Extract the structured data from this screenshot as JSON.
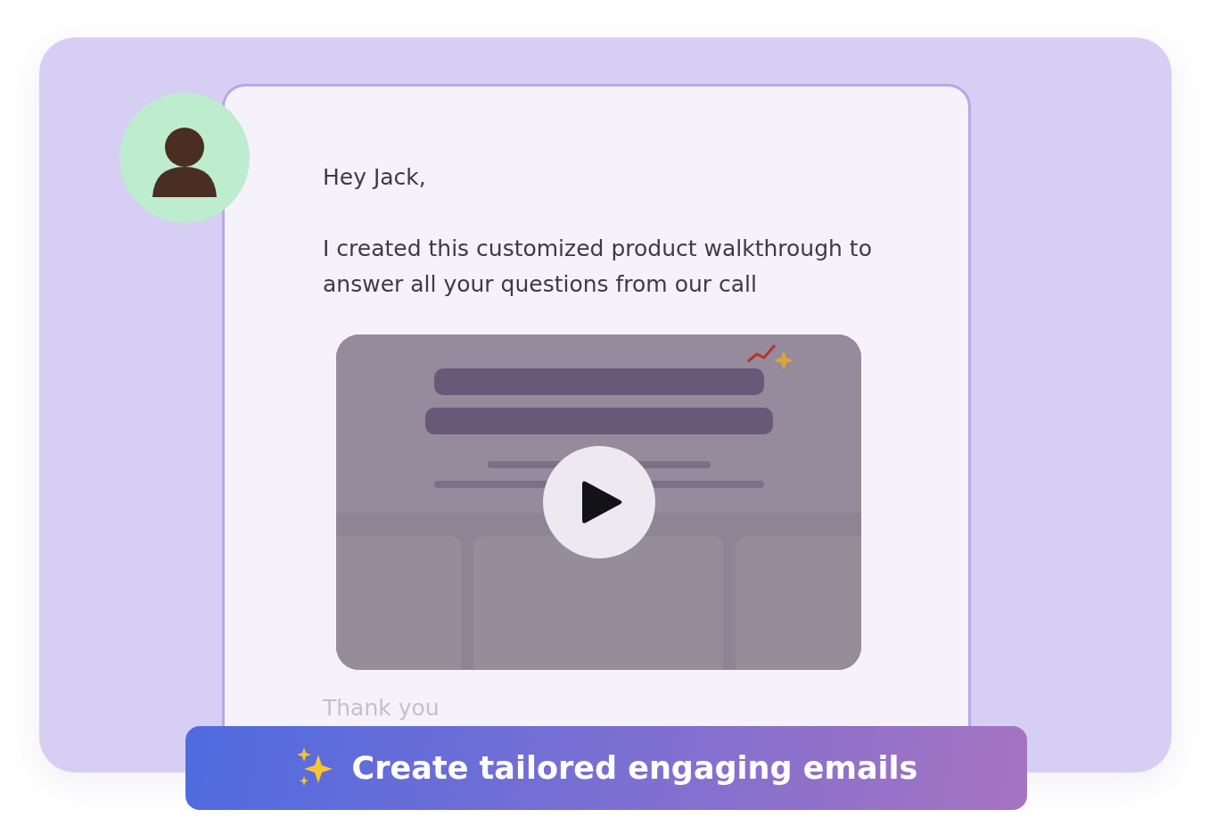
{
  "email": {
    "greeting": "Hey Jack,",
    "message": "I created this customized product walkthrough to answer all your questions from our call",
    "closing": "Thank you"
  },
  "banner": {
    "label": "Create tailored engaging emails"
  }
}
